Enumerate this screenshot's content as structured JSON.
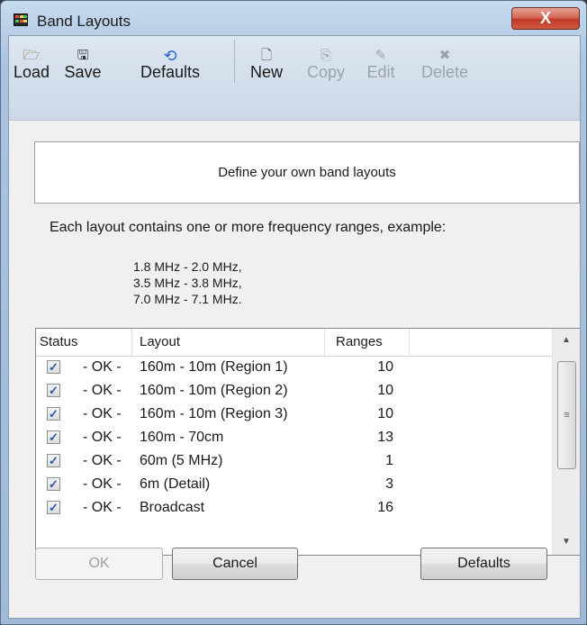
{
  "window": {
    "title": "Band Layouts",
    "close_glyph": "X"
  },
  "toolbar": {
    "load": {
      "label": "Load",
      "icon": "folder-open-icon",
      "glyph": "🗁"
    },
    "save": {
      "label": "Save",
      "icon": "floppy-disk-icon",
      "glyph": "🖫"
    },
    "defaults": {
      "label": "Defaults",
      "icon": "refresh-icon",
      "glyph": "⟲"
    },
    "new": {
      "label": "New",
      "icon": "new-document-icon",
      "glyph": "🗋"
    },
    "copy": {
      "label": "Copy",
      "icon": "copy-icon",
      "glyph": "⎘"
    },
    "edit": {
      "label": "Edit",
      "icon": "edit-icon",
      "glyph": "✎"
    },
    "delete": {
      "label": "Delete",
      "icon": "delete-icon",
      "glyph": "✖"
    }
  },
  "banner": "Define your own band layouts",
  "info": "Each layout contains one or more frequency ranges, example:",
  "examples": [
    "1.8 MHz  -  2.0 MHz,",
    "3.5 MHz  -  3.8 MHz,",
    "7.0 MHz  -  7.1 MHz."
  ],
  "list": {
    "headers": {
      "status": "Status",
      "layout": "Layout",
      "ranges": "Ranges"
    },
    "rows": [
      {
        "checked": true,
        "status": "- OK -",
        "layout": "160m - 10m (Region 1)",
        "ranges": "10"
      },
      {
        "checked": true,
        "status": "- OK -",
        "layout": "160m - 10m (Region 2)",
        "ranges": "10"
      },
      {
        "checked": true,
        "status": "- OK -",
        "layout": "160m - 10m (Region 3)",
        "ranges": "10"
      },
      {
        "checked": true,
        "status": "- OK -",
        "layout": "160m - 70cm",
        "ranges": "13"
      },
      {
        "checked": true,
        "status": "- OK -",
        "layout": "60m (5 MHz)",
        "ranges": "1"
      },
      {
        "checked": true,
        "status": "- OK -",
        "layout": "6m (Detail)",
        "ranges": "3"
      },
      {
        "checked": true,
        "status": "- OK -",
        "layout": "Broadcast",
        "ranges": "16"
      }
    ]
  },
  "buttons": {
    "ok": "OK",
    "cancel": "Cancel",
    "defaults": "Defaults"
  },
  "colors": {
    "title_bar": "#b9d1ea",
    "close_button": "#c7432f",
    "checkmark": "#2b55a5"
  }
}
